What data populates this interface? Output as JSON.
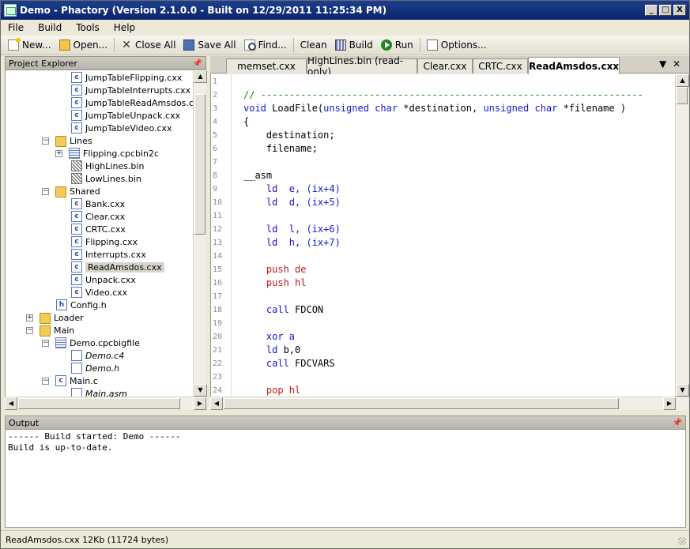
{
  "window": {
    "title": "Demo - Phactory (Version 2.1.0.0 - Built on 12/29/2011 11:25:34 PM)",
    "min": "_",
    "max": "□",
    "close": "X"
  },
  "menu": [
    "File",
    "Build",
    "Tools",
    "Help"
  ],
  "toolbar": {
    "new": "New...",
    "open": "Open...",
    "close_all": "Close All",
    "save_all": "Save All",
    "find": "Find...",
    "clean": "Clean",
    "build": "Build",
    "run": "Run",
    "options": "Options..."
  },
  "project_explorer": {
    "title": "Project Explorer",
    "pin": "📌",
    "items": [
      {
        "label": "JumpTableFlipping.cxx",
        "icon": "c-file-icon"
      },
      {
        "label": "JumpTableInterrupts.cxx",
        "icon": "c-file-icon"
      },
      {
        "label": "JumpTableReadAmsdos.cxx",
        "icon": "c-file-icon"
      },
      {
        "label": "JumpTableUnpack.cxx",
        "icon": "c-file-icon"
      },
      {
        "label": "JumpTableVideo.cxx",
        "icon": "c-file-icon"
      },
      {
        "label": "Lines",
        "icon": "folder-icon",
        "expander": "−"
      },
      {
        "label": "Flipping.cpcbin2c",
        "icon": "project-file-icon",
        "expander": "+"
      },
      {
        "label": "HighLines.bin",
        "icon": "binary-file-icon"
      },
      {
        "label": "LowLines.bin",
        "icon": "binary-file-icon"
      },
      {
        "label": "Shared",
        "icon": "folder-icon",
        "expander": "−"
      },
      {
        "label": "Bank.cxx",
        "icon": "c-file-icon"
      },
      {
        "label": "Clear.cxx",
        "icon": "c-file-icon"
      },
      {
        "label": "CRTC.cxx",
        "icon": "c-file-icon"
      },
      {
        "label": "Flipping.cxx",
        "icon": "c-file-icon"
      },
      {
        "label": "Interrupts.cxx",
        "icon": "c-file-icon"
      },
      {
        "label": "ReadAmsdos.cxx",
        "icon": "c-file-icon",
        "selected": true
      },
      {
        "label": "Unpack.cxx",
        "icon": "c-file-icon"
      },
      {
        "label": "Video.cxx",
        "icon": "c-file-icon"
      },
      {
        "label": "Config.h",
        "icon": "h-file-icon"
      },
      {
        "label": "Loader",
        "icon": "folder-icon",
        "expander": "+"
      },
      {
        "label": "Main",
        "icon": "folder-icon",
        "expander": "−"
      },
      {
        "label": "Demo.cpcbigfile",
        "icon": "project-file-icon",
        "expander": "−"
      },
      {
        "label": "Demo.c4",
        "icon": "link-file-icon",
        "italic": true
      },
      {
        "label": "Demo.h",
        "icon": "link-file-icon",
        "italic": true
      },
      {
        "label": "Main.c",
        "icon": "c-file-icon",
        "expander": "−"
      },
      {
        "label": "Main.asm",
        "icon": "link-file-icon",
        "italic": true
      }
    ]
  },
  "tabs": [
    {
      "label": "memset.cxx"
    },
    {
      "label": "HighLines.bin (read-only)"
    },
    {
      "label": "Clear.cxx"
    },
    {
      "label": "CRTC.cxx"
    },
    {
      "label": "ReadAmsdos.cxx",
      "active": true
    }
  ],
  "tab_controls": {
    "menu": "▼",
    "close": "✕"
  },
  "editor": {
    "line_numbers": [
      "1",
      "2",
      "3",
      "4",
      "5",
      "6",
      "7",
      "8",
      "9",
      "10",
      "11",
      "12",
      "13",
      "14",
      "15",
      "16",
      "17",
      "18",
      "19",
      "20",
      "21",
      "22",
      "23",
      "24"
    ],
    "lines": {
      "l2": "// -------------------------------------------------------------------",
      "l3_kw1": "void",
      "l3_fn": " LoadFile(",
      "l3_kw2": "unsigned char",
      "l3_p1": " *destination, ",
      "l3_kw3": "unsigned char",
      "l3_p2": " *filename )",
      "l4": "{",
      "l5": "    destination;",
      "l6": "    filename;",
      "l8": "__asm",
      "l9": "    ld  e, (ix+4)",
      "l10": "    ld  d, (ix+5)",
      "l12": "    ld  l, (ix+6)",
      "l13": "    ld  h, (ix+7)",
      "l15": "    push de",
      "l16": "    push hl",
      "l18_op": "    call",
      "l18_arg": " FDCON",
      "l20": "    xor a",
      "l21_op": "    ld",
      "l21_arg": " b,0",
      "l22_op": "    call",
      "l22_arg": " FDCVARS",
      "l24": "    pop hl"
    }
  },
  "output": {
    "title": "Output",
    "lines": [
      "------ Build started: Demo ------",
      "Build is up-to-date."
    ]
  },
  "status": "ReadAmsdos.cxx  12Kb (11724 bytes)"
}
